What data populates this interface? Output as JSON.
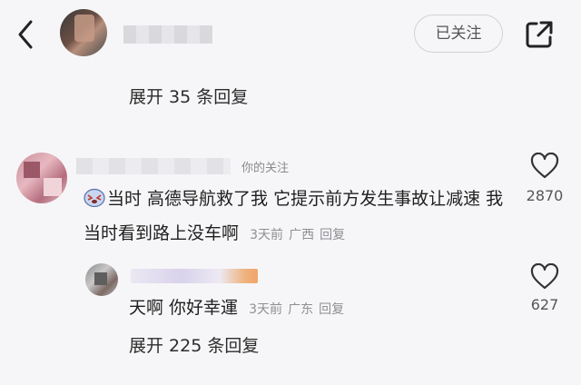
{
  "header": {
    "back_icon": "chevron-left-icon",
    "follow_label": "已关注",
    "share_icon": "share-external-icon"
  },
  "expand_top": "展开 35 条回复",
  "comment": {
    "tag": "你的关注",
    "emoji_icon": "crying-face-icon",
    "text": "当时 高德导航救了我 它提示前方发生事故让减速 我当时看到路上没车啊",
    "time": "3天前",
    "location": "广西",
    "reply_label": "回复",
    "likes": "2870"
  },
  "reply": {
    "text": "天啊 你好幸運",
    "time": "3天前",
    "location": "广东",
    "reply_label": "回复",
    "likes": "627"
  },
  "expand_bottom": "展开 225 条回复",
  "colors": {
    "background": "#f6f6f8",
    "text": "#1f1f1f",
    "meta": "#8f8f94"
  }
}
